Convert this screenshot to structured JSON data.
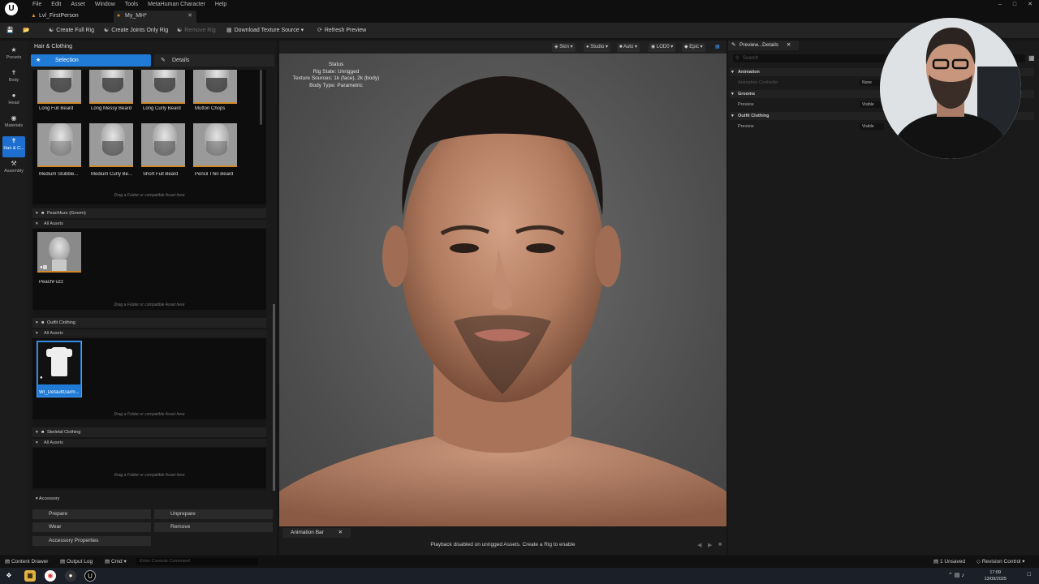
{
  "menubar": {
    "items": [
      "File",
      "Edit",
      "Asset",
      "Window",
      "Tools",
      "MetaHuman Character",
      "Help"
    ],
    "logo": "U"
  },
  "tabs": [
    {
      "label": "Lvl_FirstPerson"
    },
    {
      "label": "My_MH*"
    }
  ],
  "toolbar": {
    "create_full_rig": "Create Full Rig",
    "create_joints_only_rig": "Create Joints Only Rig",
    "remove_rig": "Remove Rig",
    "download_texture_source": "Download Texture Source",
    "refresh_preview": "Refresh Preview"
  },
  "leftnav": [
    {
      "label": "Presets"
    },
    {
      "label": "Body"
    },
    {
      "label": "Head"
    },
    {
      "label": "Materials"
    },
    {
      "label": "Hair & C..."
    },
    {
      "label": "Assembly"
    }
  ],
  "panel": {
    "title": "Hair & Clothing",
    "tab_selection": "Selection",
    "tab_details": "Details",
    "beards_row1": [
      "Long Full Beard",
      "Long Messy Beard",
      "Long Curly Beard",
      "Mutton Chops"
    ],
    "beards_row2": [
      "Medium Stubble...",
      "Medium Curly Be...",
      "Short Full Beard",
      "Pencil Thin Beard"
    ],
    "drag_hint": "Drag a Folder or compatible Asset here",
    "peachfuzz_section": "Peachfuzz (Groom)",
    "all_assets": "All Assets",
    "peachfuzz_item": "PeachFuzz",
    "outfit_section": "Outfit Clothing",
    "outfit_item": "WI_DefaultGarm...",
    "skeletal_section": "Skeletal Clothing"
  },
  "accessory": {
    "title": "Accessory",
    "prepare": "Prepare",
    "unprepare": "Unprepare",
    "wear": "Wear",
    "remove": "Remove",
    "accessory_properties": "Accessory Properties"
  },
  "viewport": {
    "buttons": [
      "Skin",
      "Studio",
      "Auto",
      "LOD0",
      "Epic"
    ],
    "status_title": "Status",
    "rig_state": "Rig State: Unrigged",
    "texture_sources": "Texture Sources: 1k (face), 2k (body)",
    "body_type": "Body Type: Parametric"
  },
  "animbar": {
    "tab": "Animation Bar",
    "message": "Playback disabled on unrigged Assets. Create a Rig to enable"
  },
  "details": {
    "tab": "Preview...Details",
    "search_placeholder": "Search",
    "animation": "Animation",
    "animation_controller": "Animation Controller",
    "animation_value": "None",
    "grooms": "Grooms",
    "preview": "Preview",
    "grooms_value": "Visible",
    "outfit_clothing": "Outfit Clothing",
    "outfit_value": "Visible"
  },
  "bottombar": {
    "content_drawer": "Content Drawer",
    "output_log": "Output Log",
    "cmd": "Cmd",
    "console_placeholder": "Enter Console Command",
    "unsaved": "1 Unsaved",
    "revision_control": "Revision Control"
  },
  "taskbar": {
    "time": "17:09",
    "date": "13/09/2025"
  }
}
